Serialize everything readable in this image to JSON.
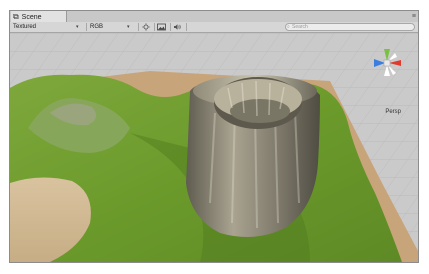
{
  "window": {
    "tab_title": "Scene",
    "menu_glyph": "≡"
  },
  "toolbar": {
    "render_mode": "Textured",
    "color_mode": "RGB",
    "search_placeholder": "Search"
  },
  "viewport": {
    "projection_label": "Persp"
  },
  "icons": {
    "tab": "scene-icon",
    "lighting": "sun-icon",
    "image": "image-icon",
    "audio": "speaker-icon",
    "search": "search-icon"
  },
  "colors": {
    "grid_bg": "#c9c9c9",
    "grass": "#6f9a2c",
    "rock": "#8f8a7b",
    "sand": "#d7bf98",
    "gizmo_x": "#e03a2e",
    "gizmo_y": "#7ac142",
    "gizmo_z": "#3b7ee0"
  }
}
